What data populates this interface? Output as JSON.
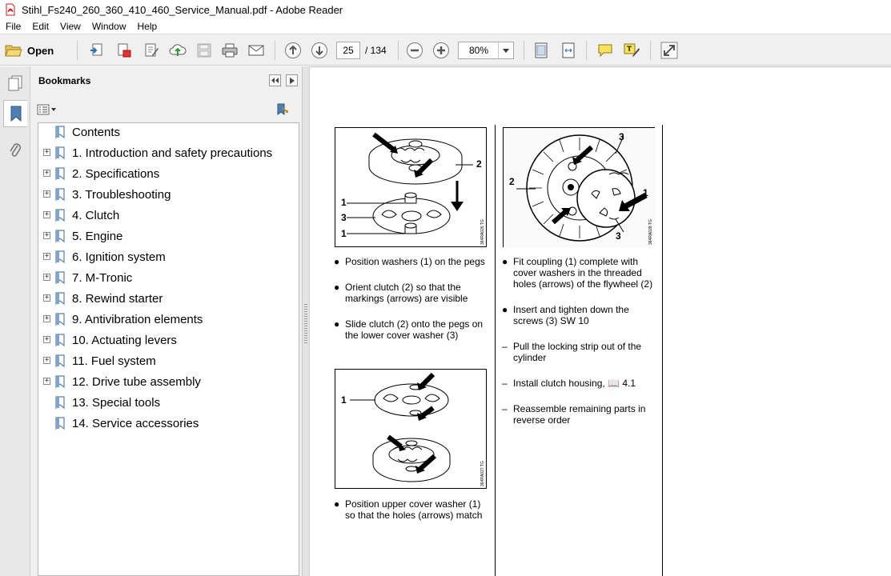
{
  "window": {
    "title": "Stihl_Fs240_260_360_410_460_Service_Manual.pdf - Adobe Reader"
  },
  "menu": [
    "File",
    "Edit",
    "View",
    "Window",
    "Help"
  ],
  "toolbar": {
    "open_label": "Open",
    "page_current": "25",
    "page_total": "/ 134",
    "zoom_value": "80%"
  },
  "bookmarks": {
    "title": "Bookmarks",
    "items": [
      {
        "label": "Contents",
        "expandable": false
      },
      {
        "label": "1. Introduction and safety precautions",
        "expandable": true
      },
      {
        "label": "2. Specifications",
        "expandable": true
      },
      {
        "label": "3. Troubleshooting",
        "expandable": true
      },
      {
        "label": "4. Clutch",
        "expandable": true
      },
      {
        "label": "5. Engine",
        "expandable": true
      },
      {
        "label": "6. Ignition system",
        "expandable": true
      },
      {
        "label": "7. M-Tronic",
        "expandable": true
      },
      {
        "label": "8. Rewind starter",
        "expandable": true
      },
      {
        "label": "9. Antivibration elements",
        "expandable": true
      },
      {
        "label": "10. Actuating levers",
        "expandable": true
      },
      {
        "label": "11. Fuel system",
        "expandable": true
      },
      {
        "label": "12. Drive tube assembly",
        "expandable": true
      },
      {
        "label": "13. Special tools",
        "expandable": false
      },
      {
        "label": "14. Service accessories",
        "expandable": false
      }
    ]
  },
  "document": {
    "figures": {
      "fig1": {
        "callouts": [
          "2",
          "1",
          "3",
          "1"
        ],
        "code": "364RA026 TG"
      },
      "fig2": {
        "callouts": [
          "1"
        ],
        "code": "364RA027 TG"
      },
      "fig3": {
        "callouts": [
          "3",
          "2",
          "1",
          "3"
        ],
        "code": "364RA028 TG"
      }
    },
    "left_steps": [
      {
        "mark": "●",
        "text": "Position washers (1) on the pegs"
      },
      {
        "mark": "●",
        "text": "Orient clutch (2) so that the\nmarkings (arrows) are visible"
      },
      {
        "mark": "●",
        "text": "Slide clutch (2) onto the pegs on\nthe lower cover washer (3)"
      },
      {
        "mark": "●",
        "text": "Position upper cover washer (1)\nso that the holes (arrows) match"
      }
    ],
    "right_steps": [
      {
        "mark": "●",
        "text": "Fit coupling (1) complete with\ncover washers in the threaded\nholes (arrows) of the flywheel (2)"
      },
      {
        "mark": "●",
        "text": "Insert and tighten down the\nscrews (3) SW 10"
      },
      {
        "mark": "–",
        "text": "Pull the locking strip out of the\ncylinder"
      },
      {
        "mark": "–",
        "text": "Install clutch housing, 📖 4.1"
      },
      {
        "mark": "–",
        "text": "Reassemble remaining parts in\nreverse order"
      }
    ]
  }
}
